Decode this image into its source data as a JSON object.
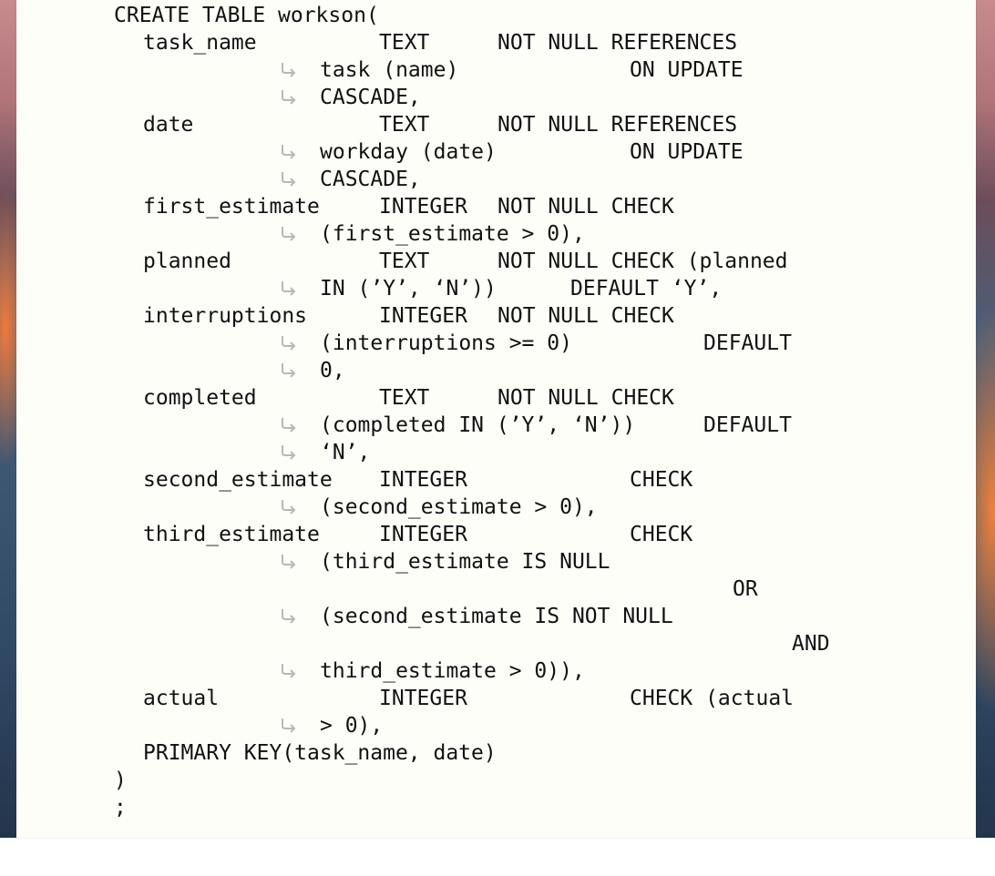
{
  "code": {
    "header": "CREATE TABLE workson(",
    "columns": [
      {
        "name": "task_name",
        "type": "TEXT",
        "constraint": "NOT NULL REFERENCES",
        "cont": [
          [
            "task (name)",
            "ON UPDATE"
          ],
          [
            "CASCADE,",
            ""
          ]
        ]
      },
      {
        "name": "date",
        "type": "TEXT",
        "constraint": "NOT NULL REFERENCES",
        "cont": [
          [
            "workday (date)",
            "ON UPDATE"
          ],
          [
            "CASCADE,",
            ""
          ]
        ]
      },
      {
        "name": "first_estimate",
        "type": "INTEGER",
        "constraint": "NOT NULL CHECK",
        "cont": [
          [
            "(first_estimate > 0),",
            ""
          ]
        ]
      },
      {
        "name": "planned",
        "type": "TEXT",
        "constraint": "NOT NULL CHECK (planned",
        "cont": [
          [
            "IN (’Y’, ‘N’))",
            "DEFAULT ‘Y’,"
          ]
        ]
      },
      {
        "name": "interruptions",
        "type": "INTEGER",
        "constraint": "NOT NULL CHECK",
        "cont": [
          [
            "(interruptions >= 0)",
            "DEFAULT"
          ],
          [
            "0,",
            ""
          ]
        ]
      },
      {
        "name": "completed",
        "type": "TEXT",
        "constraint": "NOT NULL CHECK",
        "cont": [
          [
            "(completed IN (’Y’, ‘N’))",
            "DEFAULT"
          ],
          [
            "‘N’,",
            ""
          ]
        ]
      },
      {
        "name": "second_estimate",
        "type": "INTEGER",
        "constraint": "CHECK",
        "cont": [
          [
            "(second_estimate > 0),",
            ""
          ]
        ]
      },
      {
        "name": "third_estimate",
        "type": "INTEGER",
        "constraint": "CHECK",
        "cont": [
          [
            "(third_estimate IS NULL",
            ""
          ]
        ],
        "extra1": "OR",
        "cont2": [
          [
            "(second_estimate IS NOT NULL",
            ""
          ]
        ],
        "extra2": "AND",
        "cont3": [
          [
            "third_estimate > 0)),",
            ""
          ]
        ]
      },
      {
        "name": "actual",
        "type": "INTEGER",
        "constraint": "CHECK (actual",
        "cont": [
          [
            "> 0),",
            ""
          ]
        ]
      }
    ],
    "primary_key": "PRIMARY KEY(task_name, date)",
    "close_paren": ")",
    "semicolon": ";"
  },
  "colors": {
    "page_bg": "#fefef9",
    "text": "#111111",
    "wrap_icon": "#b8b8b8"
  },
  "icons": {
    "line_wrap": "line-wrap-icon"
  }
}
